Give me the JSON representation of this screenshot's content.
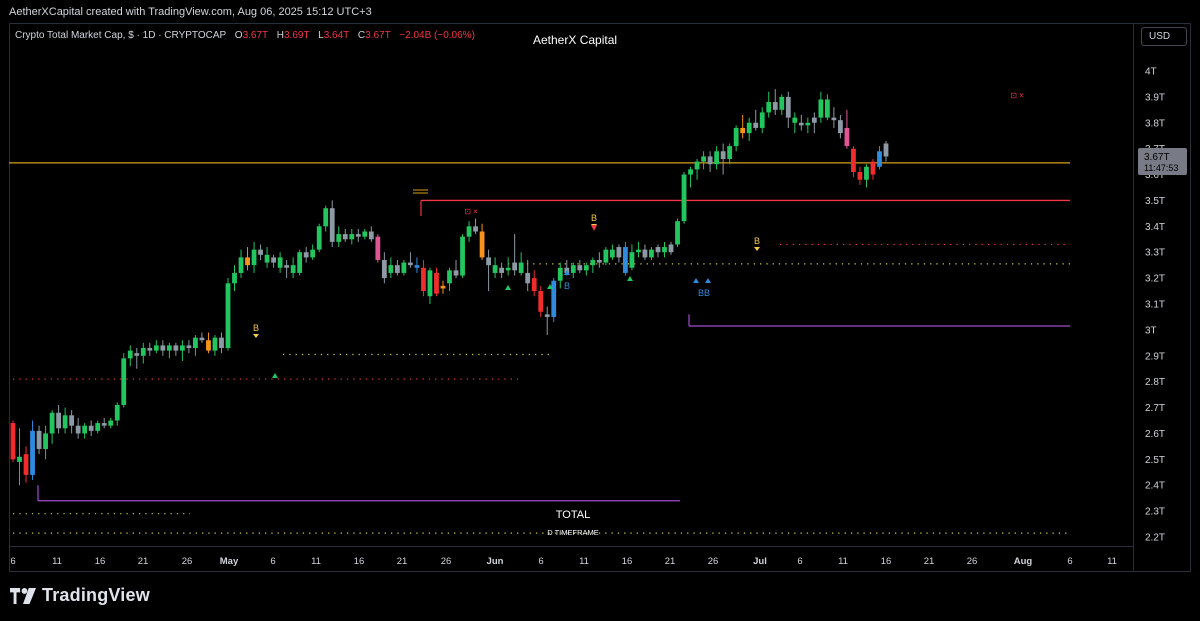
{
  "header": {
    "credit": "AetherXCapital created with TradingView.com, Aug 06, 2025 15:12 UTC+3"
  },
  "legend": {
    "symbol": "Crypto Total Market Cap, $ · 1D · CRYPTOCAP",
    "open_label": "O",
    "open": "3.67T",
    "high_label": "H",
    "high": "3.69T",
    "low_label": "L",
    "low": "3.64T",
    "close_label": "C",
    "close": "3.67T",
    "change": "−2.04B (−0.06%)"
  },
  "watermark_title": "AetherX Capital",
  "currency_button": "USD",
  "price_tag": {
    "price": "3.67T",
    "countdown": "11:47:53"
  },
  "labels": {
    "total": "TOTAL",
    "timeframe": "D TIMEFRAME"
  },
  "brand": "TradingView",
  "colors": {
    "up": "#22c55e",
    "down": "#ef2d2d",
    "neutral": "#8d9aa5",
    "blue": "#2f8be0",
    "orange": "#f7931a",
    "pink": "#e05594",
    "purple": "#a24bd0"
  },
  "chart_data": {
    "type": "candlestick",
    "y_ticks": [
      "4T",
      "3.9T",
      "3.8T",
      "3.7T",
      "3.6T",
      "3.5T",
      "3.4T",
      "3.3T",
      "3.2T",
      "3.1T",
      "3T",
      "2.9T",
      "2.8T",
      "2.7T",
      "2.6T",
      "2.5T",
      "2.4T",
      "2.3T",
      "2.2T"
    ],
    "ylim": [
      2.2,
      4.0
    ],
    "x_ticks": [
      "6",
      "11",
      "16",
      "21",
      "26",
      "May",
      "6",
      "11",
      "16",
      "21",
      "26",
      "Jun",
      "6",
      "11",
      "16",
      "21",
      "26",
      "Jul",
      "6",
      "11",
      "16",
      "21",
      "26",
      "Aug",
      "6",
      "11"
    ],
    "markers": {
      "buy": [
        "B",
        "B",
        "B",
        "B",
        "B",
        "B",
        "B"
      ],
      "sell": [
        "⊡ ×",
        "⊡ ×"
      ],
      "b_with_triangle": [
        "B",
        "B",
        "B",
        "B"
      ]
    },
    "levels": [
      {
        "price": 3.645,
        "color": "#d4a017",
        "style": "solid",
        "from": "start",
        "to": "end"
      },
      {
        "price": 3.5,
        "color": "#f23645",
        "style": "solid",
        "from": "Apr 23",
        "to": "end"
      },
      {
        "price": 3.33,
        "color": "#f23645",
        "style": "dotted",
        "from": "Jul 8",
        "to": "end"
      },
      {
        "price": 3.255,
        "color": "#c9c940",
        "style": "dotted",
        "from": "Jun 3",
        "to": "end"
      },
      {
        "price": 3.015,
        "color": "#a24bd0",
        "style": "solid",
        "from": "Jun 24",
        "to": "end"
      },
      {
        "price": 2.905,
        "color": "#c9c940",
        "style": "dotted",
        "from": "May 6",
        "to": "Jun 7"
      },
      {
        "price": 2.81,
        "color": "#f23645",
        "style": "dotted",
        "from": "Apr 6",
        "to": "May 16"
      },
      {
        "price": 2.34,
        "color": "#a24bd0",
        "style": "solid",
        "from": "Apr 8",
        "to": "Jun 23"
      },
      {
        "price": 2.29,
        "color": "#c9c940",
        "style": "dotted",
        "from": "Apr 6",
        "to": "Apr 22"
      },
      {
        "price": 2.215,
        "color": "#c9c940",
        "style": "dotted",
        "from": "Apr 6",
        "to": "end"
      }
    ],
    "candles": [
      {
        "o": 2.64,
        "h": 2.65,
        "l": 2.49,
        "c": 2.5,
        "t": "r"
      },
      {
        "o": 2.49,
        "h": 2.62,
        "l": 2.4,
        "c": 2.51,
        "t": "g"
      },
      {
        "o": 2.52,
        "h": 2.55,
        "l": 2.41,
        "c": 2.44,
        "t": "r"
      },
      {
        "o": 2.44,
        "h": 2.65,
        "l": 2.42,
        "c": 2.61,
        "t": "b"
      },
      {
        "o": 2.61,
        "h": 2.63,
        "l": 2.52,
        "c": 2.54,
        "t": "n"
      },
      {
        "o": 2.54,
        "h": 2.63,
        "l": 2.5,
        "c": 2.6,
        "t": "g"
      },
      {
        "o": 2.6,
        "h": 2.69,
        "l": 2.56,
        "c": 2.68,
        "t": "g"
      },
      {
        "o": 2.68,
        "h": 2.71,
        "l": 2.6,
        "c": 2.62,
        "t": "n"
      },
      {
        "o": 2.62,
        "h": 2.7,
        "l": 2.6,
        "c": 2.67,
        "t": "g"
      },
      {
        "o": 2.67,
        "h": 2.69,
        "l": 2.6,
        "c": 2.63,
        "t": "n"
      },
      {
        "o": 2.63,
        "h": 2.66,
        "l": 2.58,
        "c": 2.6,
        "t": "n"
      },
      {
        "o": 2.6,
        "h": 2.64,
        "l": 2.58,
        "c": 2.63,
        "t": "g"
      },
      {
        "o": 2.63,
        "h": 2.65,
        "l": 2.59,
        "c": 2.61,
        "t": "n"
      },
      {
        "o": 2.61,
        "h": 2.65,
        "l": 2.6,
        "c": 2.64,
        "t": "g"
      },
      {
        "o": 2.64,
        "h": 2.66,
        "l": 2.62,
        "c": 2.63,
        "t": "n"
      },
      {
        "o": 2.63,
        "h": 2.66,
        "l": 2.62,
        "c": 2.65,
        "t": "g"
      },
      {
        "o": 2.65,
        "h": 2.72,
        "l": 2.63,
        "c": 2.71,
        "t": "g"
      },
      {
        "o": 2.71,
        "h": 2.91,
        "l": 2.7,
        "c": 2.89,
        "t": "g"
      },
      {
        "o": 2.89,
        "h": 2.94,
        "l": 2.86,
        "c": 2.92,
        "t": "g"
      },
      {
        "o": 2.91,
        "h": 2.93,
        "l": 2.85,
        "c": 2.9,
        "t": "n"
      },
      {
        "o": 2.9,
        "h": 2.95,
        "l": 2.87,
        "c": 2.93,
        "t": "g"
      },
      {
        "o": 2.93,
        "h": 2.95,
        "l": 2.9,
        "c": 2.92,
        "t": "n"
      },
      {
        "o": 2.92,
        "h": 2.96,
        "l": 2.91,
        "c": 2.94,
        "t": "g"
      },
      {
        "o": 2.94,
        "h": 2.96,
        "l": 2.9,
        "c": 2.92,
        "t": "n"
      },
      {
        "o": 2.92,
        "h": 2.95,
        "l": 2.89,
        "c": 2.94,
        "t": "g"
      },
      {
        "o": 2.94,
        "h": 2.95,
        "l": 2.9,
        "c": 2.92,
        "t": "n"
      },
      {
        "o": 2.92,
        "h": 2.96,
        "l": 2.88,
        "c": 2.94,
        "t": "g"
      },
      {
        "o": 2.94,
        "h": 2.96,
        "l": 2.91,
        "c": 2.93,
        "t": "n"
      },
      {
        "o": 2.93,
        "h": 2.98,
        "l": 2.9,
        "c": 2.97,
        "t": "g"
      },
      {
        "o": 2.97,
        "h": 2.99,
        "l": 2.95,
        "c": 2.96,
        "t": "n"
      },
      {
        "o": 2.96,
        "h": 2.99,
        "l": 2.91,
        "c": 2.92,
        "t": "o"
      },
      {
        "o": 2.92,
        "h": 2.98,
        "l": 2.9,
        "c": 2.97,
        "t": "g"
      },
      {
        "o": 2.97,
        "h": 2.99,
        "l": 2.91,
        "c": 2.93,
        "t": "n"
      },
      {
        "o": 2.93,
        "h": 3.2,
        "l": 2.92,
        "c": 3.18,
        "t": "g"
      },
      {
        "o": 3.18,
        "h": 3.25,
        "l": 3.15,
        "c": 3.22,
        "t": "g"
      },
      {
        "o": 3.22,
        "h": 3.31,
        "l": 3.2,
        "c": 3.28,
        "t": "g"
      },
      {
        "o": 3.28,
        "h": 3.32,
        "l": 3.23,
        "c": 3.25,
        "t": "o"
      },
      {
        "o": 3.25,
        "h": 3.34,
        "l": 3.22,
        "c": 3.31,
        "t": "g"
      },
      {
        "o": 3.31,
        "h": 3.33,
        "l": 3.27,
        "c": 3.29,
        "t": "n"
      },
      {
        "o": 3.29,
        "h": 3.32,
        "l": 3.24,
        "c": 3.26,
        "t": "g"
      },
      {
        "o": 3.26,
        "h": 3.29,
        "l": 3.24,
        "c": 3.28,
        "t": "n"
      },
      {
        "o": 3.28,
        "h": 3.3,
        "l": 3.22,
        "c": 3.24,
        "t": "g"
      },
      {
        "o": 3.24,
        "h": 3.27,
        "l": 3.2,
        "c": 3.25,
        "t": "n"
      },
      {
        "o": 3.25,
        "h": 3.28,
        "l": 3.2,
        "c": 3.22,
        "t": "g"
      },
      {
        "o": 3.22,
        "h": 3.31,
        "l": 3.21,
        "c": 3.3,
        "t": "g"
      },
      {
        "o": 3.3,
        "h": 3.32,
        "l": 3.26,
        "c": 3.28,
        "t": "n"
      },
      {
        "o": 3.28,
        "h": 3.33,
        "l": 3.27,
        "c": 3.31,
        "t": "g"
      },
      {
        "o": 3.31,
        "h": 3.41,
        "l": 3.3,
        "c": 3.4,
        "t": "g"
      },
      {
        "o": 3.4,
        "h": 3.48,
        "l": 3.38,
        "c": 3.47,
        "t": "g"
      },
      {
        "o": 3.47,
        "h": 3.5,
        "l": 3.32,
        "c": 3.34,
        "t": "n"
      },
      {
        "o": 3.34,
        "h": 3.4,
        "l": 3.32,
        "c": 3.37,
        "t": "g"
      },
      {
        "o": 3.37,
        "h": 3.39,
        "l": 3.34,
        "c": 3.35,
        "t": "n"
      },
      {
        "o": 3.35,
        "h": 3.39,
        "l": 3.33,
        "c": 3.37,
        "t": "g"
      },
      {
        "o": 3.37,
        "h": 3.39,
        "l": 3.34,
        "c": 3.36,
        "t": "n"
      },
      {
        "o": 3.36,
        "h": 3.39,
        "l": 3.35,
        "c": 3.38,
        "t": "g"
      },
      {
        "o": 3.38,
        "h": 3.4,
        "l": 3.34,
        "c": 3.35,
        "t": "n"
      },
      {
        "o": 3.36,
        "h": 3.37,
        "l": 3.26,
        "c": 3.27,
        "t": "p"
      },
      {
        "o": 3.27,
        "h": 3.3,
        "l": 3.18,
        "c": 3.2,
        "t": "n"
      },
      {
        "o": 3.22,
        "h": 3.28,
        "l": 3.2,
        "c": 3.25,
        "t": "g"
      },
      {
        "o": 3.25,
        "h": 3.27,
        "l": 3.21,
        "c": 3.22,
        "t": "n"
      },
      {
        "o": 3.22,
        "h": 3.27,
        "l": 3.21,
        "c": 3.26,
        "t": "g"
      },
      {
        "o": 3.26,
        "h": 3.3,
        "l": 3.24,
        "c": 3.25,
        "t": "n"
      },
      {
        "o": 3.25,
        "h": 3.28,
        "l": 3.22,
        "c": 3.24,
        "t": "b"
      },
      {
        "o": 3.24,
        "h": 3.27,
        "l": 3.13,
        "c": 3.15,
        "t": "r"
      },
      {
        "o": 3.13,
        "h": 3.24,
        "l": 3.1,
        "c": 3.23,
        "t": "g"
      },
      {
        "o": 3.22,
        "h": 3.24,
        "l": 3.13,
        "c": 3.14,
        "t": "r"
      },
      {
        "o": 3.16,
        "h": 3.19,
        "l": 3.14,
        "c": 3.17,
        "t": "o"
      },
      {
        "o": 3.18,
        "h": 3.24,
        "l": 3.15,
        "c": 3.23,
        "t": "g"
      },
      {
        "o": 3.23,
        "h": 3.27,
        "l": 3.2,
        "c": 3.21,
        "t": "n"
      },
      {
        "o": 3.21,
        "h": 3.37,
        "l": 3.2,
        "c": 3.36,
        "t": "g"
      },
      {
        "o": 3.36,
        "h": 3.42,
        "l": 3.34,
        "c": 3.4,
        "t": "g"
      },
      {
        "o": 3.4,
        "h": 3.43,
        "l": 3.37,
        "c": 3.38,
        "t": "n"
      },
      {
        "o": 3.38,
        "h": 3.41,
        "l": 3.27,
        "c": 3.28,
        "t": "o"
      },
      {
        "o": 3.28,
        "h": 3.31,
        "l": 3.15,
        "c": 3.25,
        "t": "n"
      },
      {
        "o": 3.25,
        "h": 3.28,
        "l": 3.2,
        "c": 3.22,
        "t": "g"
      },
      {
        "o": 3.22,
        "h": 3.26,
        "l": 3.2,
        "c": 3.24,
        "t": "n"
      },
      {
        "o": 3.24,
        "h": 3.28,
        "l": 3.21,
        "c": 3.23,
        "t": "g"
      },
      {
        "o": 3.23,
        "h": 3.37,
        "l": 3.21,
        "c": 3.26,
        "t": "n"
      },
      {
        "o": 3.26,
        "h": 3.3,
        "l": 3.21,
        "c": 3.22,
        "t": "g"
      },
      {
        "o": 3.22,
        "h": 3.27,
        "l": 3.15,
        "c": 3.18,
        "t": "n"
      },
      {
        "o": 3.2,
        "h": 3.23,
        "l": 3.13,
        "c": 3.15,
        "t": "r"
      },
      {
        "o": 3.15,
        "h": 3.17,
        "l": 3.05,
        "c": 3.07,
        "t": "r"
      },
      {
        "o": 3.06,
        "h": 3.09,
        "l": 2.98,
        "c": 3.05,
        "t": "n"
      },
      {
        "o": 3.05,
        "h": 3.2,
        "l": 3.03,
        "c": 3.19,
        "t": "b"
      },
      {
        "o": 3.19,
        "h": 3.26,
        "l": 3.16,
        "c": 3.24,
        "t": "g"
      },
      {
        "o": 3.24,
        "h": 3.27,
        "l": 3.21,
        "c": 3.22,
        "t": "n"
      },
      {
        "o": 3.22,
        "h": 3.26,
        "l": 3.2,
        "c": 3.25,
        "t": "g"
      },
      {
        "o": 3.25,
        "h": 3.27,
        "l": 3.22,
        "c": 3.23,
        "t": "n"
      },
      {
        "o": 3.23,
        "h": 3.26,
        "l": 3.21,
        "c": 3.25,
        "t": "g"
      },
      {
        "o": 3.25,
        "h": 3.28,
        "l": 3.22,
        "c": 3.27,
        "t": "g"
      },
      {
        "o": 3.27,
        "h": 3.3,
        "l": 3.24,
        "c": 3.26,
        "t": "n"
      },
      {
        "o": 3.26,
        "h": 3.32,
        "l": 3.25,
        "c": 3.31,
        "t": "g"
      },
      {
        "o": 3.31,
        "h": 3.33,
        "l": 3.27,
        "c": 3.28,
        "t": "g"
      },
      {
        "o": 3.28,
        "h": 3.33,
        "l": 3.26,
        "c": 3.32,
        "t": "n"
      },
      {
        "o": 3.32,
        "h": 3.34,
        "l": 3.21,
        "c": 3.22,
        "t": "b"
      },
      {
        "o": 3.24,
        "h": 3.33,
        "l": 3.23,
        "c": 3.3,
        "t": "g"
      },
      {
        "o": 3.3,
        "h": 3.34,
        "l": 3.28,
        "c": 3.31,
        "t": "g"
      },
      {
        "o": 3.31,
        "h": 3.33,
        "l": 3.27,
        "c": 3.28,
        "t": "n"
      },
      {
        "o": 3.28,
        "h": 3.32,
        "l": 3.27,
        "c": 3.31,
        "t": "g"
      },
      {
        "o": 3.3,
        "h": 3.33,
        "l": 3.28,
        "c": 3.32,
        "t": "n"
      },
      {
        "o": 3.32,
        "h": 3.34,
        "l": 3.28,
        "c": 3.3,
        "t": "g"
      },
      {
        "o": 3.3,
        "h": 3.34,
        "l": 3.29,
        "c": 3.33,
        "t": "n"
      },
      {
        "o": 3.33,
        "h": 3.43,
        "l": 3.32,
        "c": 3.42,
        "t": "g"
      },
      {
        "o": 3.42,
        "h": 3.61,
        "l": 3.41,
        "c": 3.6,
        "t": "g"
      },
      {
        "o": 3.6,
        "h": 3.63,
        "l": 3.55,
        "c": 3.62,
        "t": "g"
      },
      {
        "o": 3.62,
        "h": 3.66,
        "l": 3.58,
        "c": 3.65,
        "t": "g"
      },
      {
        "o": 3.65,
        "h": 3.69,
        "l": 3.62,
        "c": 3.67,
        "t": "g"
      },
      {
        "o": 3.67,
        "h": 3.69,
        "l": 3.61,
        "c": 3.64,
        "t": "n"
      },
      {
        "o": 3.64,
        "h": 3.71,
        "l": 3.62,
        "c": 3.69,
        "t": "g"
      },
      {
        "o": 3.69,
        "h": 3.72,
        "l": 3.6,
        "c": 3.66,
        "t": "n"
      },
      {
        "o": 3.66,
        "h": 3.72,
        "l": 3.64,
        "c": 3.71,
        "t": "g"
      },
      {
        "o": 3.71,
        "h": 3.79,
        "l": 3.69,
        "c": 3.78,
        "t": "g"
      },
      {
        "o": 3.78,
        "h": 3.83,
        "l": 3.74,
        "c": 3.76,
        "t": "o"
      },
      {
        "o": 3.76,
        "h": 3.82,
        "l": 3.73,
        "c": 3.8,
        "t": "g"
      },
      {
        "o": 3.8,
        "h": 3.85,
        "l": 3.77,
        "c": 3.78,
        "t": "n"
      },
      {
        "o": 3.78,
        "h": 3.86,
        "l": 3.76,
        "c": 3.84,
        "t": "g"
      },
      {
        "o": 3.84,
        "h": 3.92,
        "l": 3.82,
        "c": 3.88,
        "t": "g"
      },
      {
        "o": 3.88,
        "h": 3.93,
        "l": 3.83,
        "c": 3.85,
        "t": "n"
      },
      {
        "o": 3.85,
        "h": 3.91,
        "l": 3.83,
        "c": 3.9,
        "t": "g"
      },
      {
        "o": 3.9,
        "h": 3.92,
        "l": 3.78,
        "c": 3.82,
        "t": "n"
      },
      {
        "o": 3.82,
        "h": 3.84,
        "l": 3.76,
        "c": 3.8,
        "t": "g"
      },
      {
        "o": 3.8,
        "h": 3.83,
        "l": 3.77,
        "c": 3.79,
        "t": "n"
      },
      {
        "o": 3.79,
        "h": 3.82,
        "l": 3.76,
        "c": 3.8,
        "t": "g"
      },
      {
        "o": 3.8,
        "h": 3.84,
        "l": 3.76,
        "c": 3.82,
        "t": "n"
      },
      {
        "o": 3.82,
        "h": 3.92,
        "l": 3.8,
        "c": 3.89,
        "t": "g"
      },
      {
        "o": 3.89,
        "h": 3.91,
        "l": 3.81,
        "c": 3.82,
        "t": "g"
      },
      {
        "o": 3.82,
        "h": 3.86,
        "l": 3.78,
        "c": 3.81,
        "t": "n"
      },
      {
        "o": 3.81,
        "h": 3.83,
        "l": 3.74,
        "c": 3.76,
        "t": "n"
      },
      {
        "o": 3.78,
        "h": 3.85,
        "l": 3.7,
        "c": 3.71,
        "t": "p"
      },
      {
        "o": 3.7,
        "h": 3.71,
        "l": 3.59,
        "c": 3.61,
        "t": "r"
      },
      {
        "o": 3.61,
        "h": 3.63,
        "l": 3.56,
        "c": 3.58,
        "t": "r"
      },
      {
        "o": 3.58,
        "h": 3.64,
        "l": 3.55,
        "c": 3.63,
        "t": "g"
      },
      {
        "o": 3.6,
        "h": 3.66,
        "l": 3.58,
        "c": 3.65,
        "t": "r"
      },
      {
        "o": 3.63,
        "h": 3.71,
        "l": 3.62,
        "c": 3.69,
        "t": "b"
      },
      {
        "o": 3.72,
        "h": 3.73,
        "l": 3.65,
        "c": 3.67,
        "t": "n"
      }
    ]
  }
}
